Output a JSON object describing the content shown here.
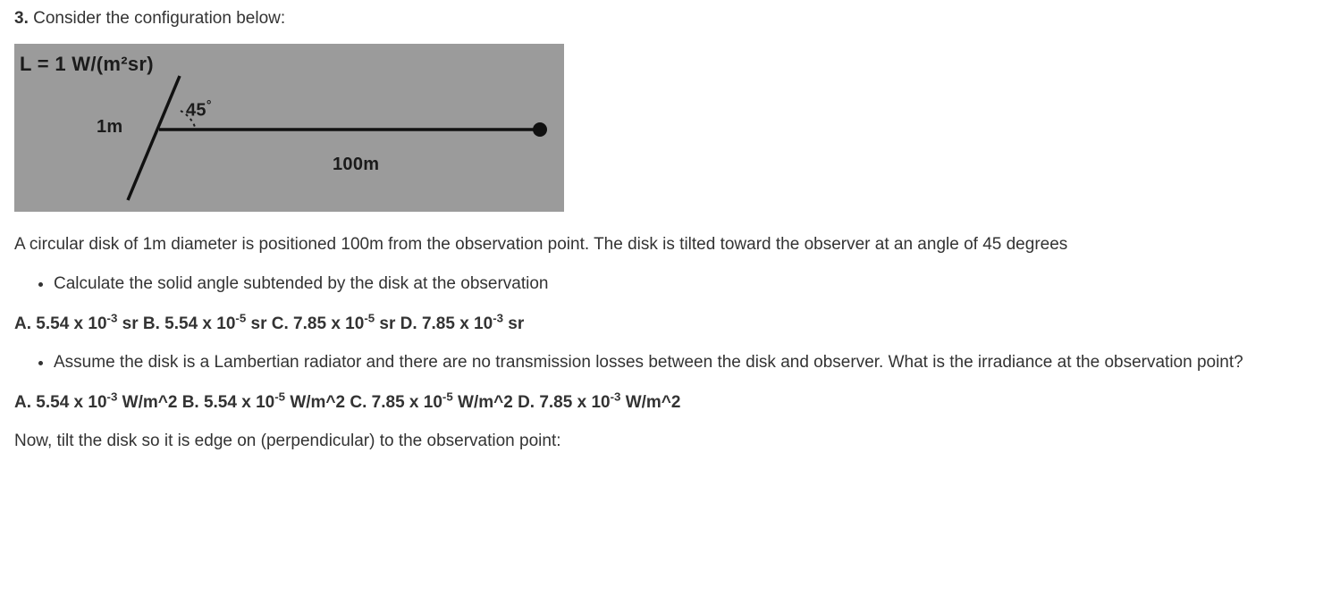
{
  "question": {
    "number": "3.",
    "prompt": "Consider the configuration below:"
  },
  "figure": {
    "radiance_label": "L = 1 W/(m²sr)",
    "disk_length_label": "1m",
    "angle_label": "45",
    "angle_unit": "°",
    "distance_label": "100m"
  },
  "description": "A circular disk of 1m diameter is positioned 100m from the observation point. The disk is tilted toward the observer at an angle of 45 degrees",
  "part1": {
    "prompt": "Calculate the solid angle subtended by the disk at the observation",
    "choices": {
      "A_label": "A.  5.54 x 10",
      "A_exp": "-3",
      "A_unit": " sr",
      "B_label": " B. 5.54 x 10",
      "B_exp": "-5",
      "B_unit": " sr ",
      "C_label": " C. 7.85 x 10",
      "C_exp": "-5",
      "C_unit": " sr ",
      "D_label": " D. 7.85 x 10",
      "D_exp": "-3",
      "D_unit": " sr"
    }
  },
  "part2": {
    "prompt": "Assume the disk is a Lambertian radiator and there are no transmission losses between the disk and observer. What is the irradiance at the observation point?",
    "choices": {
      "A_label": "A. 5.54 x 10",
      "A_exp": "-3",
      "A_unit": " W/m^2 ",
      "B_label": " B. 5.54 x 10",
      "B_exp": "-5",
      "B_unit": " W/m^2 ",
      "C_label": " C. 7.85 x 10",
      "C_exp": "-5",
      "C_unit": " W/m^2 ",
      "D_label": "D. 7.85 x 10",
      "D_exp": "-3",
      "D_unit": " W/m^2"
    }
  },
  "followup": "Now, tilt the disk so it is edge on (perpendicular) to the observation point:"
}
